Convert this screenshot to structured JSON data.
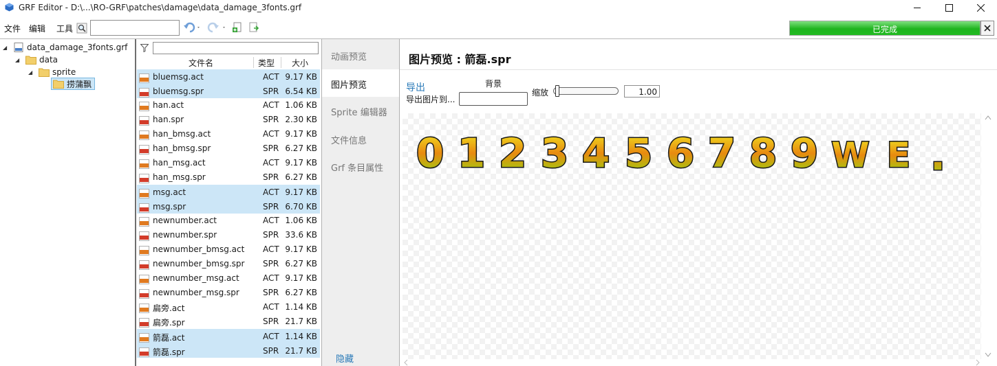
{
  "window": {
    "title": "GRF Editor - D:\\...\\RO-GRF\\patches\\damage\\data_damage_3fonts.grf",
    "minimize_icon": "minimize-icon",
    "maximize_icon": "maximize-icon",
    "close_icon": "close-icon"
  },
  "menu": {
    "file": "文件",
    "edit": "编辑",
    "tools": "工具"
  },
  "toolbar": {
    "search_value": "",
    "icons": [
      "search-icon",
      "undo-icon",
      "redo-icon",
      "add-file-icon",
      "extract-icon"
    ],
    "progress_label": "已完成",
    "progress_percent": 100,
    "progress_color": "#22bb22"
  },
  "tree": {
    "root": "data_damage_3fonts.grf",
    "data": "data",
    "sprite": "sprite",
    "selected": "捞蒲飘"
  },
  "filelist": {
    "filter_value": "",
    "headers": {
      "name": "文件名",
      "type": "类型",
      "size": "大小"
    },
    "files": [
      {
        "name": "bluemsg.act",
        "type": "ACT",
        "size": "9.17 KB",
        "selected": true
      },
      {
        "name": "bluemsg.spr",
        "type": "SPR",
        "size": "6.54 KB",
        "selected": true
      },
      {
        "name": "han.act",
        "type": "ACT",
        "size": "1.06 KB",
        "selected": false
      },
      {
        "name": "han.spr",
        "type": "SPR",
        "size": "2.30 KB",
        "selected": false
      },
      {
        "name": "han_bmsg.act",
        "type": "ACT",
        "size": "9.17 KB",
        "selected": false
      },
      {
        "name": "han_bmsg.spr",
        "type": "SPR",
        "size": "6.27 KB",
        "selected": false
      },
      {
        "name": "han_msg.act",
        "type": "ACT",
        "size": "9.17 KB",
        "selected": false
      },
      {
        "name": "han_msg.spr",
        "type": "SPR",
        "size": "6.27 KB",
        "selected": false
      },
      {
        "name": "msg.act",
        "type": "ACT",
        "size": "9.17 KB",
        "selected": true
      },
      {
        "name": "msg.spr",
        "type": "SPR",
        "size": "6.70 KB",
        "selected": true
      },
      {
        "name": "newnumber.act",
        "type": "ACT",
        "size": "1.06 KB",
        "selected": false
      },
      {
        "name": "newnumber.spr",
        "type": "SPR",
        "size": "33.6 KB",
        "selected": false
      },
      {
        "name": "newnumber_bmsg.act",
        "type": "ACT",
        "size": "9.17 KB",
        "selected": false
      },
      {
        "name": "newnumber_bmsg.spr",
        "type": "SPR",
        "size": "6.27 KB",
        "selected": false
      },
      {
        "name": "newnumber_msg.act",
        "type": "ACT",
        "size": "9.17 KB",
        "selected": false
      },
      {
        "name": "newnumber_msg.spr",
        "type": "SPR",
        "size": "6.27 KB",
        "selected": false
      },
      {
        "name": "扁旁.act",
        "type": "ACT",
        "size": "1.14 KB",
        "selected": false
      },
      {
        "name": "扁旁.spr",
        "type": "SPR",
        "size": "21.7 KB",
        "selected": false
      },
      {
        "name": "箭磊.act",
        "type": "ACT",
        "size": "1.14 KB",
        "selected": true
      },
      {
        "name": "箭磊.spr",
        "type": "SPR",
        "size": "21.7 KB",
        "selected": true
      }
    ]
  },
  "tabs": {
    "items": [
      "动画预览",
      "图片预览",
      "Sprite 编辑器",
      "文件信息",
      "Grf 条目属性"
    ],
    "active_index": 1,
    "hide": "隐藏"
  },
  "preview": {
    "title": "图片预览 : 箭磊.spr",
    "export": "导出",
    "export_to": "导出图片到...",
    "background_label": "背景",
    "zoom_label": "缩放",
    "zoom_value": "1.00",
    "slider_level": 0,
    "glyphs": [
      "0",
      "1",
      "2",
      "3",
      "4",
      "5",
      "6",
      "7",
      "8",
      "9",
      "W",
      "E",
      "."
    ],
    "glyph_colors": {
      "top": "#f0e020",
      "mid": "#e88a10",
      "bottom": "#9ad010",
      "outline": "#1a1a1a"
    }
  }
}
